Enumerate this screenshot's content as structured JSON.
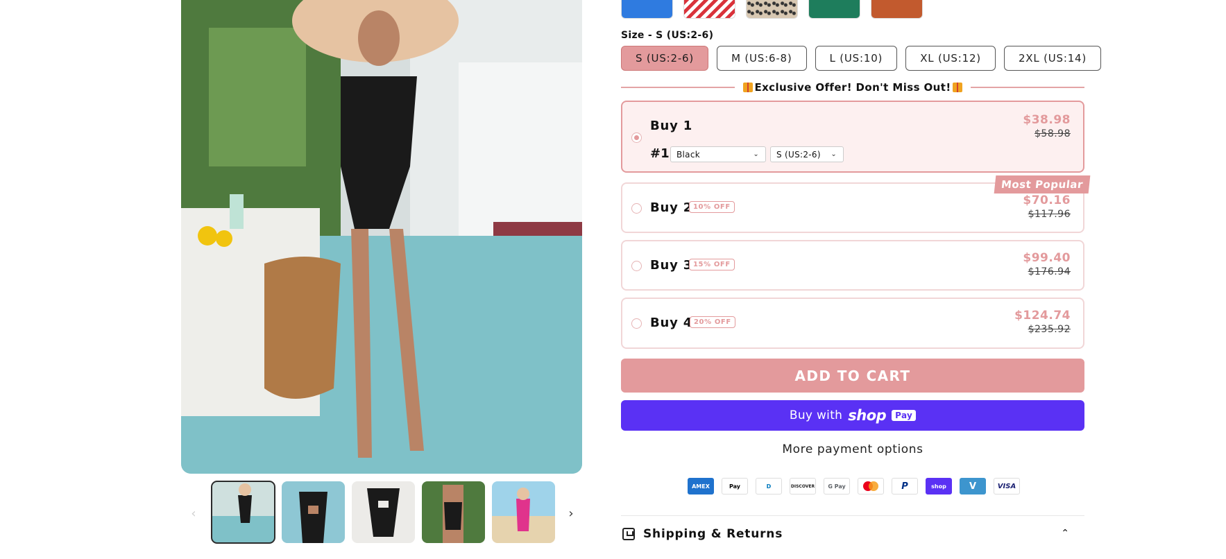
{
  "gallery": {
    "main_image": "woman in black cut-out one-piece swimsuit and sun hat by pool",
    "prev_label": "‹",
    "next_label": "›",
    "thumbnails": [
      "thumb-front-black",
      "thumb-closeup-black",
      "thumb-flatlay-black",
      "thumb-back-black",
      "thumb-pink-beach"
    ]
  },
  "swatches": [
    "blue",
    "red-white-stripe",
    "leopard",
    "green",
    "rust"
  ],
  "size": {
    "label": "Size - S (US:2-6)",
    "options": [
      "S (US:2-6)",
      "M (US:6-8)",
      "L (US:10)",
      "XL (US:12)",
      "2XL (US:14)"
    ],
    "selected": "S (US:2-6)"
  },
  "offer": {
    "text": "Exclusive Offer! Don't Miss Out!"
  },
  "bundles": [
    {
      "title": "Buy 1",
      "badge": "",
      "price": "$38.98",
      "was": "$58.98",
      "selected": true,
      "row_label": "#1",
      "color_select": "Black",
      "size_select": "S (US:2-6)"
    },
    {
      "title": "Buy 2",
      "badge": "10% OFF",
      "price": "$70.16",
      "was": "$117.96",
      "tag": "Most Popular"
    },
    {
      "title": "Buy 3",
      "badge": "15% OFF",
      "price": "$99.40",
      "was": "$176.94"
    },
    {
      "title": "Buy 4",
      "badge": "20% OFF",
      "price": "$124.74",
      "was": "$235.92"
    }
  ],
  "actions": {
    "add_to_cart": "ADD TO CART",
    "buy_with": "Buy with",
    "shop_logo": "shop",
    "shop_pay": "Pay",
    "more_payment": "More payment options"
  },
  "payment_icons": [
    {
      "name": "amex",
      "label": "AMEX"
    },
    {
      "name": "apple-pay",
      "label": "Pay"
    },
    {
      "name": "diners",
      "label": "D"
    },
    {
      "name": "discover",
      "label": "DISCOVER"
    },
    {
      "name": "google-pay",
      "label": "G Pay"
    },
    {
      "name": "mastercard",
      "label": ""
    },
    {
      "name": "paypal",
      "label": "P"
    },
    {
      "name": "shop-pay",
      "label": "shop"
    },
    {
      "name": "venmo",
      "label": "V"
    },
    {
      "name": "visa",
      "label": "VISA"
    }
  ],
  "shipping": {
    "label": "Shipping & Returns"
  },
  "colors": {
    "accent": "#e39a9c",
    "shop_pay": "#5a31f4"
  }
}
